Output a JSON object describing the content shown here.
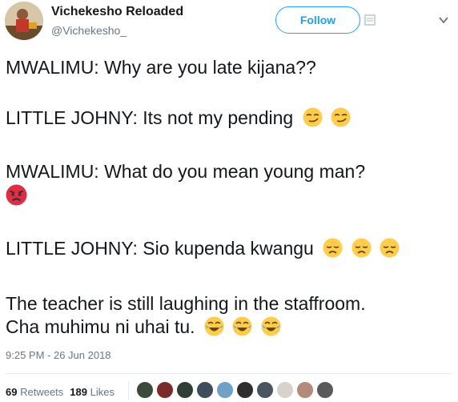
{
  "tweet": {
    "author_name": "Vichekesho Reloaded",
    "author_handle": "@Vichekesho_",
    "follow_label": "Follow",
    "lines": [
      {
        "text": "MWALIMU: Why are you late kijana??",
        "emojis": []
      },
      {
        "text": "LITTLE JOHNY: Its not my pending",
        "emojis": [
          "smirk",
          "smirk"
        ]
      },
      {
        "text": "MWALIMU: What do you mean young man?",
        "emojis": []
      },
      {
        "text": "",
        "emojis": [
          "angry"
        ]
      },
      {
        "text": "LITTLE JOHNY: Sio kupenda kwangu",
        "emojis": [
          "disappointed",
          "disappointed",
          "disappointed"
        ]
      },
      {
        "text": "The teacher is still laughing in the staffroom.",
        "emojis": []
      },
      {
        "text": "Cha muhimu ni uhai tu.",
        "emojis": [
          "joy",
          "joy",
          "joy"
        ]
      }
    ],
    "timestamp": "9:25 PM - 26 Jun 2018",
    "retweets_count": "69",
    "retweets_label": "Retweets",
    "likes_count": "189",
    "likes_label": "Likes",
    "liker_avatar_colors": [
      "#3b4a3a",
      "#7a2a2a",
      "#2f3f35",
      "#3e4d5c",
      "#6fa0c8",
      "#2e2e2e",
      "#4a5560",
      "#d9d2cc",
      "#b48a7a",
      "#5a5a5a"
    ]
  },
  "colors": {
    "accent": "#1da1f2",
    "text": "#14171a",
    "muted": "#657786"
  }
}
